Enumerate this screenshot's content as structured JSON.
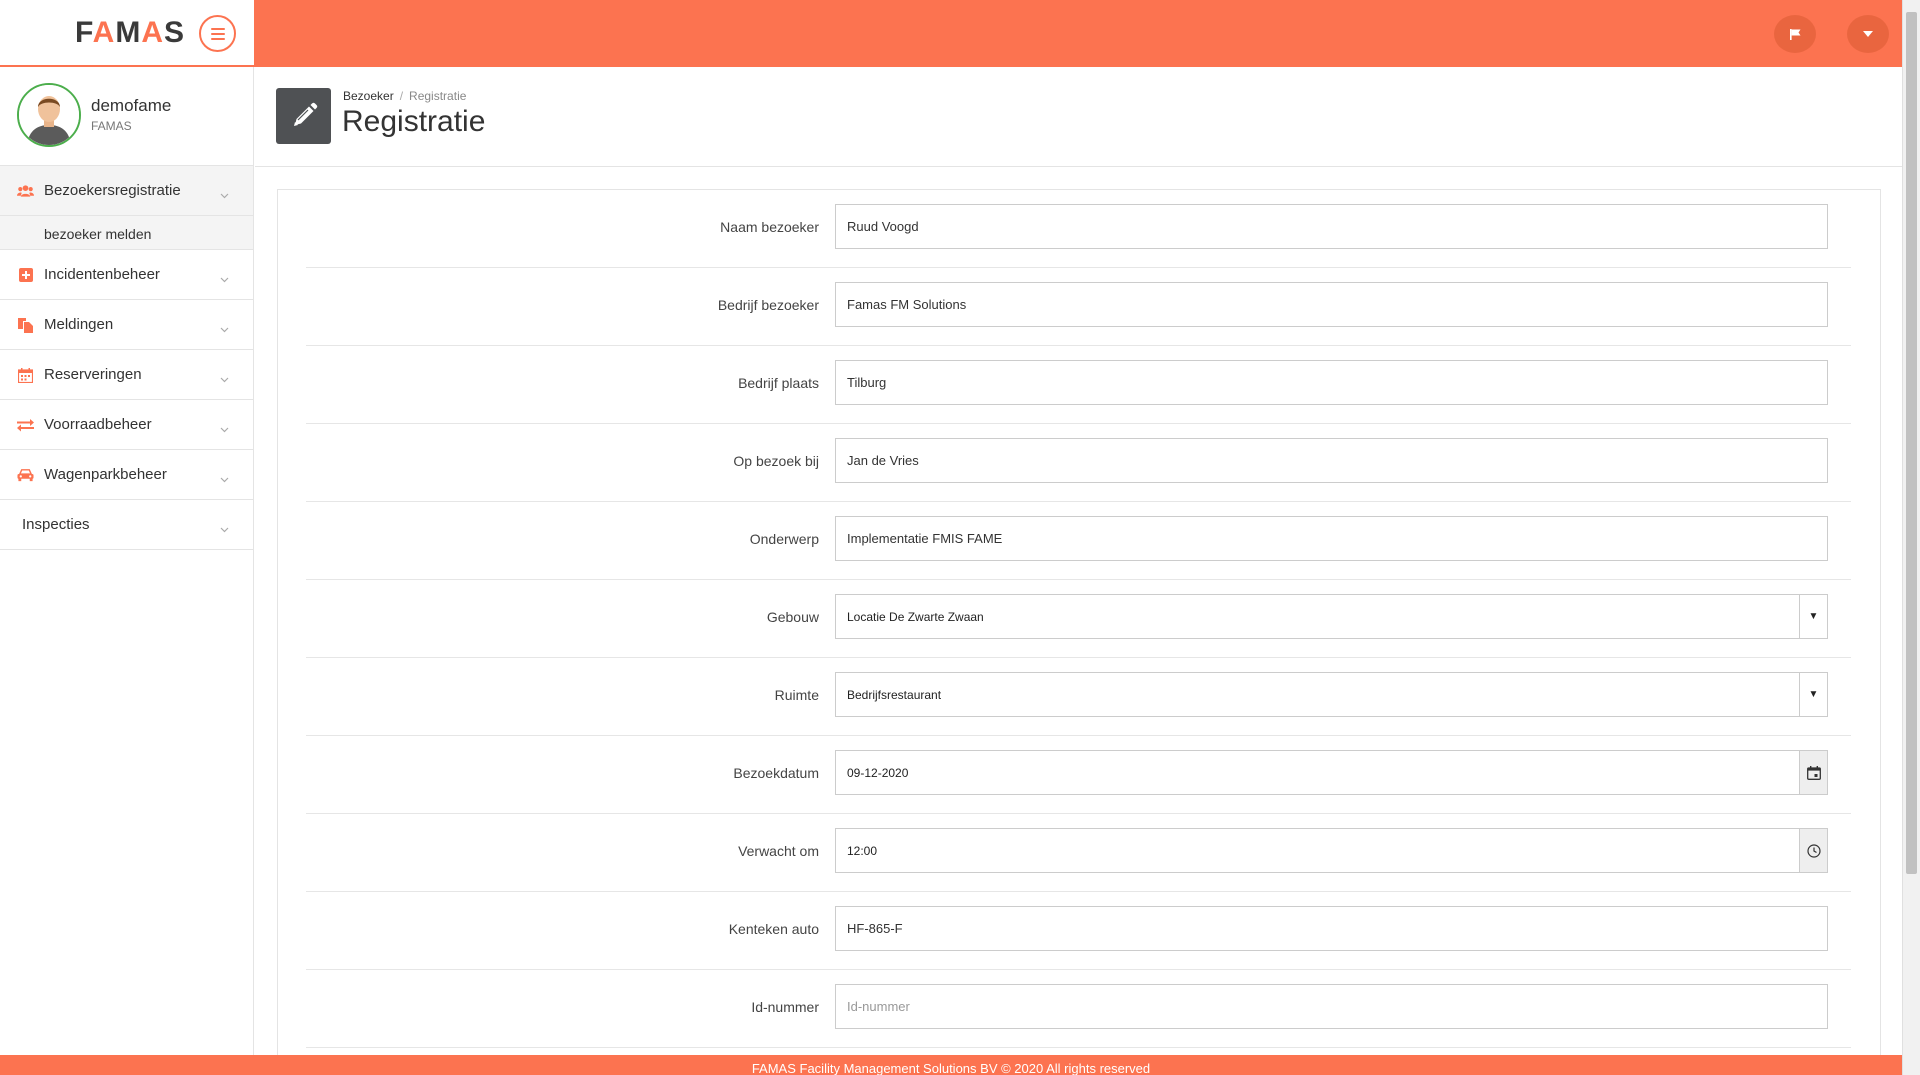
{
  "app": {
    "logo": "FAMAS",
    "accent_color": "#fc7350"
  },
  "topbar": {
    "menu_icon": "hamburger-icon",
    "flag_icon": "flag-icon",
    "dropdown_icon": "caret-down-icon"
  },
  "user": {
    "name": "demofame",
    "org": "FAMAS"
  },
  "sidebar": {
    "items": [
      {
        "label": "Bezoekersregistratie",
        "icon": "users-icon"
      },
      {
        "label": "bezoeker melden"
      },
      {
        "label": "Incidentenbeheer",
        "icon": "plus-square-icon"
      },
      {
        "label": "Meldingen",
        "icon": "copy-icon"
      },
      {
        "label": "Reserveringen",
        "icon": "calendar-icon"
      },
      {
        "label": "Voorraadbeheer",
        "icon": "exchange-icon"
      },
      {
        "label": "Wagenparkbeheer",
        "icon": "car-icon"
      },
      {
        "label": "Inspecties"
      }
    ]
  },
  "header": {
    "breadcrumb": [
      "Bezoeker",
      "Registratie"
    ],
    "title": "Registratie",
    "icon": "pencil-icon"
  },
  "form": {
    "fields": [
      {
        "label": "Naam bezoeker",
        "value": "Ruud Voogd"
      },
      {
        "label": "Bedrijf bezoeker",
        "value": "Famas FM Solutions"
      },
      {
        "label": "Bedrijf plaats",
        "value": "Tilburg"
      },
      {
        "label": "Op bezoek bij",
        "value": "Jan de Vries"
      },
      {
        "label": "Onderwerp",
        "value": "Implementatie FMIS FAME"
      },
      {
        "label": "Gebouw",
        "value": "Locatie De Zwarte Zwaan"
      },
      {
        "label": "Ruimte",
        "value": "Bedrijfsrestaurant"
      },
      {
        "label": "Bezoekdatum",
        "value": "09-12-2020"
      },
      {
        "label": "Verwacht om",
        "value": "12:00"
      },
      {
        "label": "Kenteken auto",
        "value": "HF-865-F"
      },
      {
        "label": "Id-nummer",
        "value": "",
        "placeholder": "Id-nummer"
      }
    ]
  },
  "footer": {
    "text": "FAMAS Facility Management Solutions BV © 2020 All rights reserved"
  }
}
